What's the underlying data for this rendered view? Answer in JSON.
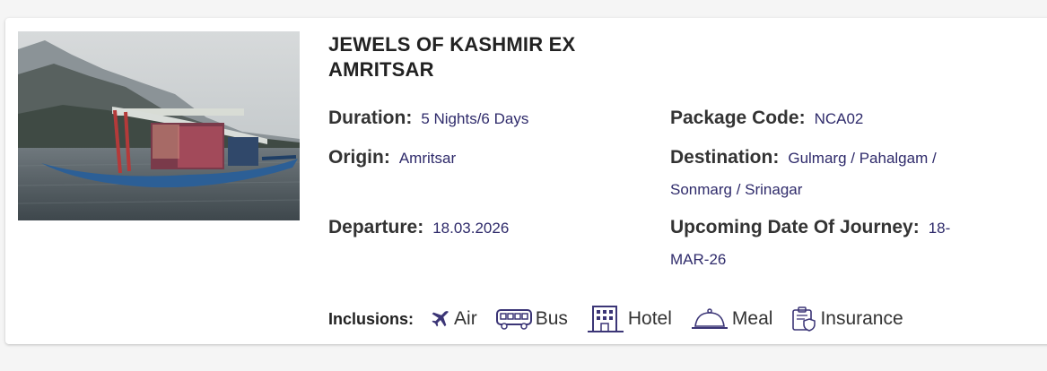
{
  "package": {
    "title": "JEWELS OF KASHMIR EX AMRITSAR",
    "image_alt": "Shikara boat on Dal Lake"
  },
  "details": {
    "duration_label": "Duration:",
    "duration_value": "5 Nights/6 Days",
    "package_code_label": "Package Code:",
    "package_code_value": "NCA02",
    "origin_label": "Origin:",
    "origin_value": "Amritsar",
    "destination_label": "Destination:",
    "destination_value": "Gulmarg / Pahalgam / Sonmarg / Srinagar",
    "departure_label": "Departure:",
    "departure_value": "18.03.2026",
    "upcoming_label": "Upcoming Date Of Journey:",
    "upcoming_value": "18-MAR-26"
  },
  "inclusions": {
    "label": "Inclusions:",
    "items": [
      {
        "name": "Air",
        "icon": "plane-icon"
      },
      {
        "name": "Bus",
        "icon": "bus-icon"
      },
      {
        "name": "Hotel",
        "icon": "hotel-icon"
      },
      {
        "name": "Meal",
        "icon": "meal-icon"
      },
      {
        "name": "Insurance",
        "icon": "insurance-icon"
      }
    ]
  },
  "colors": {
    "value_text": "#2f2b6b",
    "icon_accent": "#3b3576",
    "label_text": "#333333"
  }
}
